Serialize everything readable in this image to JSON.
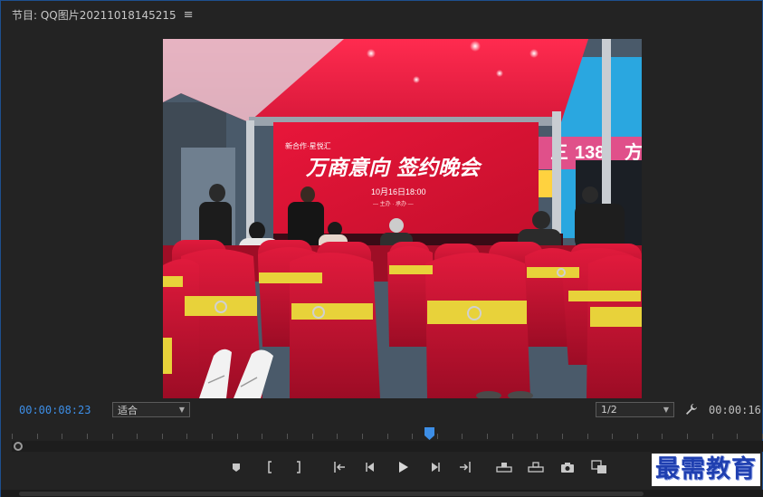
{
  "header": {
    "title": "节目: QQ图片20211018145215",
    "menu_icon": "≡"
  },
  "viewer": {
    "image_description_icon": "program-frame",
    "stage_screen": {
      "brand": "新合作·星悦汇",
      "headline": "万商意向 签约晚会",
      "date": "10月16日18:00",
      "sub": "— 主办 · 承办 —"
    },
    "signs": [
      "三",
      "138",
      "方"
    ]
  },
  "playback": {
    "current_timecode": "00:00:08:23",
    "fit_label": "适合",
    "resolution_label": "1/2",
    "duration_timecode": "00:00:16:"
  },
  "timeline": {
    "playhead_fraction": 0.566
  },
  "watermark": {
    "text": "最需教育"
  },
  "colors": {
    "accent_blue": "#3d8ee6",
    "panel_bg": "#232323",
    "border": "#1e4f8f"
  }
}
